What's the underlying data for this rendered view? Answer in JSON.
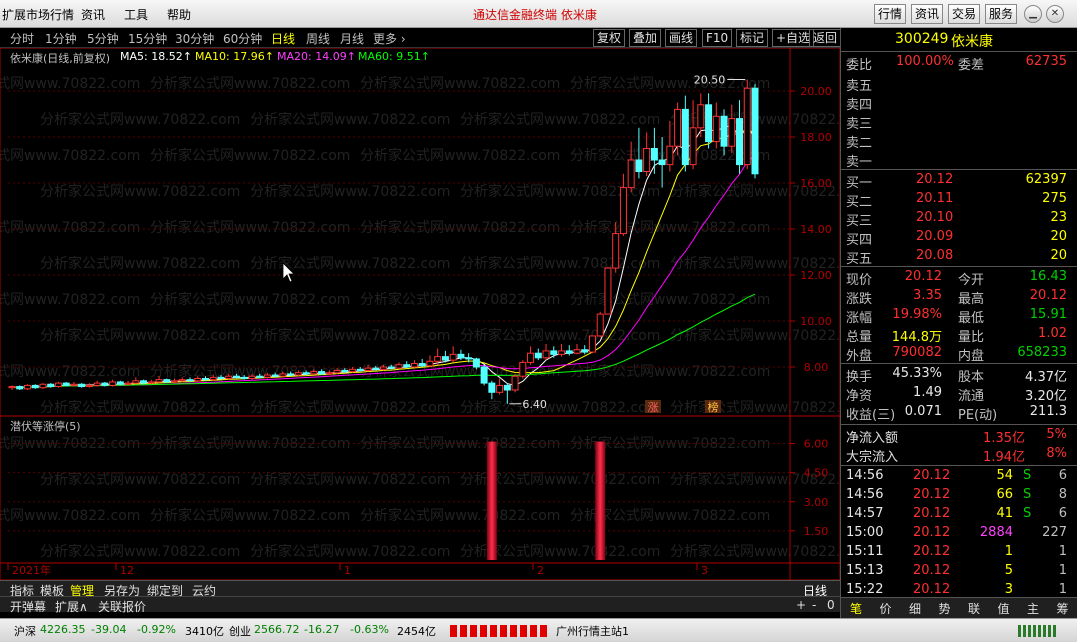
{
  "titlebar": {
    "menus": [
      "扩展市场行情",
      "资讯",
      "工具",
      "帮助"
    ],
    "center_title": "通达信金融终端   依米康",
    "buttons": [
      "行情",
      "资讯",
      "交易",
      "服务"
    ]
  },
  "periods": [
    "分时",
    "1分钟",
    "5分钟",
    "15分钟",
    "30分钟",
    "60分钟",
    "日线",
    "周线",
    "月线",
    "更多 ›"
  ],
  "active_period": "日线",
  "tools": [
    "复权",
    "叠加",
    "画线",
    "F10",
    "标记",
    "+自选",
    "返回"
  ],
  "ma_legend": {
    "name": "依米康(日线,前复权)",
    "ma5": "MA5: 18.52↑",
    "ma10": "MA10: 17.96↑",
    "ma20": "MA20: 14.09↑",
    "ma60": "MA60: 9.51↑"
  },
  "chart_data": {
    "type": "candlestick",
    "price_axis_ticks": [
      "20.00",
      "18.00",
      "16.00",
      "14.00",
      "12.00",
      "10.00",
      "8.00"
    ],
    "ylim": [
      6.0,
      21.0
    ],
    "high_annotation": "20.50",
    "low_annotation": "6.40",
    "x_labels": [
      "2021年",
      "12",
      "1",
      "2",
      "3"
    ],
    "markers": [
      "涨",
      "榜"
    ],
    "candles": [
      [
        7.1,
        7.15,
        7.0,
        7.2
      ],
      [
        7.15,
        7.05,
        7.0,
        7.2
      ],
      [
        7.05,
        7.2,
        7.0,
        7.25
      ],
      [
        7.2,
        7.1,
        7.05,
        7.25
      ],
      [
        7.1,
        7.25,
        7.05,
        7.3
      ],
      [
        7.25,
        7.15,
        7.1,
        7.3
      ],
      [
        7.15,
        7.3,
        7.1,
        7.35
      ],
      [
        7.3,
        7.2,
        7.15,
        7.35
      ],
      [
        7.2,
        7.25,
        7.15,
        7.35
      ],
      [
        7.25,
        7.15,
        7.1,
        7.3
      ],
      [
        7.15,
        7.2,
        7.1,
        7.3
      ],
      [
        7.2,
        7.3,
        7.15,
        7.4
      ],
      [
        7.3,
        7.2,
        7.15,
        7.35
      ],
      [
        7.2,
        7.35,
        7.15,
        7.45
      ],
      [
        7.35,
        7.25,
        7.2,
        7.4
      ],
      [
        7.25,
        7.3,
        7.2,
        7.4
      ],
      [
        7.3,
        7.4,
        7.25,
        7.55
      ],
      [
        7.4,
        7.3,
        7.25,
        7.45
      ],
      [
        7.3,
        7.35,
        7.25,
        7.45
      ],
      [
        7.35,
        7.45,
        7.3,
        7.6
      ],
      [
        7.45,
        7.35,
        7.3,
        7.5
      ],
      [
        7.35,
        7.4,
        7.3,
        7.5
      ],
      [
        7.4,
        7.45,
        7.35,
        7.55
      ],
      [
        7.45,
        7.4,
        7.35,
        7.55
      ],
      [
        7.4,
        7.5,
        7.35,
        7.6
      ],
      [
        7.5,
        7.45,
        7.4,
        7.6
      ],
      [
        7.45,
        7.55,
        7.4,
        7.65
      ],
      [
        7.55,
        7.5,
        7.45,
        7.65
      ],
      [
        7.5,
        7.6,
        7.45,
        7.7
      ],
      [
        7.6,
        7.55,
        7.5,
        7.7
      ],
      [
        7.55,
        7.5,
        7.45,
        7.65
      ],
      [
        7.5,
        7.6,
        7.45,
        7.7
      ],
      [
        7.6,
        7.55,
        7.5,
        7.7
      ],
      [
        7.55,
        7.65,
        7.5,
        7.75
      ],
      [
        7.65,
        7.6,
        7.55,
        7.75
      ],
      [
        7.6,
        7.7,
        7.55,
        7.8
      ],
      [
        7.7,
        7.65,
        7.6,
        7.8
      ],
      [
        7.65,
        7.75,
        7.6,
        7.85
      ],
      [
        7.75,
        7.7,
        7.65,
        7.85
      ],
      [
        7.7,
        7.8,
        7.65,
        7.9
      ],
      [
        7.8,
        7.7,
        7.65,
        7.9
      ],
      [
        7.7,
        7.75,
        7.65,
        7.85
      ],
      [
        7.75,
        7.85,
        7.7,
        7.95
      ],
      [
        7.85,
        7.8,
        7.75,
        7.95
      ],
      [
        7.8,
        7.9,
        7.75,
        8.0
      ],
      [
        7.9,
        7.85,
        7.8,
        8.0
      ],
      [
        7.85,
        7.95,
        7.8,
        8.1
      ],
      [
        7.95,
        7.9,
        7.85,
        8.05
      ],
      [
        7.9,
        8.0,
        7.85,
        8.1
      ],
      [
        8.0,
        7.95,
        7.9,
        8.1
      ],
      [
        7.95,
        8.1,
        7.9,
        8.2
      ],
      [
        8.1,
        8.0,
        7.95,
        8.25
      ],
      [
        8.0,
        8.15,
        7.95,
        8.3
      ],
      [
        8.15,
        8.05,
        8.0,
        8.35
      ],
      [
        8.05,
        8.25,
        8.0,
        8.5
      ],
      [
        8.25,
        8.45,
        8.1,
        8.8
      ],
      [
        8.45,
        8.3,
        8.2,
        8.7
      ],
      [
        8.3,
        8.55,
        8.2,
        8.9
      ],
      [
        8.55,
        8.4,
        8.3,
        8.75
      ],
      [
        8.4,
        8.35,
        8.2,
        8.6
      ],
      [
        8.35,
        8.0,
        7.9,
        8.4
      ],
      [
        8.0,
        7.3,
        7.2,
        8.1
      ],
      [
        7.3,
        6.9,
        6.6,
        7.4
      ],
      [
        6.9,
        7.2,
        6.8,
        7.5
      ],
      [
        7.2,
        7.0,
        6.4,
        7.3
      ],
      [
        7.0,
        7.6,
        6.9,
        7.7
      ],
      [
        7.6,
        8.2,
        7.5,
        8.3
      ],
      [
        8.2,
        8.6,
        8.1,
        8.9
      ],
      [
        8.6,
        8.4,
        8.3,
        8.8
      ],
      [
        8.4,
        8.7,
        8.3,
        9.0
      ],
      [
        8.7,
        8.55,
        8.4,
        8.9
      ],
      [
        8.55,
        8.7,
        8.45,
        9.0
      ],
      [
        8.7,
        8.6,
        8.5,
        8.95
      ],
      [
        8.6,
        8.75,
        8.55,
        9.0
      ],
      [
        8.75,
        8.65,
        8.55,
        8.95
      ],
      [
        8.65,
        9.35,
        8.6,
        9.35
      ],
      [
        9.35,
        10.3,
        9.3,
        10.4
      ],
      [
        10.3,
        12.3,
        10.3,
        12.35
      ],
      [
        12.3,
        13.8,
        12.1,
        14.3
      ],
      [
        13.8,
        15.8,
        13.7,
        16.4
      ],
      [
        15.8,
        17.0,
        15.6,
        17.8
      ],
      [
        17.0,
        16.5,
        16.2,
        18.4
      ],
      [
        16.5,
        17.5,
        16.3,
        18.2
      ],
      [
        17.5,
        17.0,
        16.4,
        18.4
      ],
      [
        17.0,
        16.8,
        15.8,
        18.0
      ],
      [
        16.8,
        17.6,
        16.5,
        18.7
      ],
      [
        17.6,
        19.2,
        17.2,
        19.5
      ],
      [
        19.2,
        16.8,
        16.5,
        19.8
      ],
      [
        16.8,
        18.4,
        16.6,
        19.6
      ],
      [
        18.4,
        19.4,
        18.0,
        19.9
      ],
      [
        19.4,
        17.8,
        17.5,
        19.9
      ],
      [
        17.8,
        18.9,
        17.5,
        19.5
      ],
      [
        18.9,
        17.6,
        17.2,
        19.2
      ],
      [
        17.6,
        18.8,
        17.3,
        19.4
      ],
      [
        18.8,
        16.8,
        16.4,
        19.6
      ],
      [
        16.8,
        20.12,
        16.6,
        20.5
      ],
      [
        20.12,
        16.4,
        16.2,
        20.3
      ]
    ],
    "ma_colors": {
      "ma5": "#ffffff",
      "ma10": "#ffff00",
      "ma20": "#ff00ff",
      "ma60": "#00ff00"
    }
  },
  "indicator": {
    "title": "潜伏等涨停(5)",
    "ticks": [
      "6.00",
      "4.50",
      "3.00",
      "1.50"
    ],
    "bars_at": [
      62,
      76
    ]
  },
  "bottom_tabs": [
    "指标",
    "模板",
    "管理",
    "另存为",
    "绑定到",
    "云约"
  ],
  "period_label": "日线",
  "sub_tabs": [
    "开弹幕",
    "扩展∧",
    "关联报价"
  ],
  "scroll_controls": [
    "+",
    "-",
    "0"
  ],
  "stock": {
    "code": "300249",
    "name": "依米康"
  },
  "weibi": {
    "label": "委比",
    "value": "100.00%",
    "label2": "委差",
    "value2": "62735"
  },
  "sells": [
    {
      "label": "卖五",
      "price": "",
      "vol": ""
    },
    {
      "label": "卖四",
      "price": "",
      "vol": ""
    },
    {
      "label": "卖三",
      "price": "",
      "vol": ""
    },
    {
      "label": "卖二",
      "price": "",
      "vol": ""
    },
    {
      "label": "卖一",
      "price": "",
      "vol": ""
    }
  ],
  "buys": [
    {
      "label": "买一",
      "price": "20.12",
      "vol": "62397"
    },
    {
      "label": "买二",
      "price": "20.11",
      "vol": "275"
    },
    {
      "label": "买三",
      "price": "20.10",
      "vol": "23"
    },
    {
      "label": "买四",
      "price": "20.09",
      "vol": "20"
    },
    {
      "label": "买五",
      "price": "20.08",
      "vol": "20"
    }
  ],
  "quote": [
    {
      "l1": "现价",
      "v1": "20.12",
      "c1": "red",
      "l2": "今开",
      "v2": "16.43",
      "c2": "grn"
    },
    {
      "l1": "涨跌",
      "v1": "3.35",
      "c1": "red",
      "l2": "最高",
      "v2": "20.12",
      "c2": "red"
    },
    {
      "l1": "涨幅",
      "v1": "19.98%",
      "c1": "red",
      "l2": "最低",
      "v2": "15.91",
      "c2": "grn"
    },
    {
      "l1": "总量",
      "v1": "144.8万",
      "c1": "yel",
      "l2": "量比",
      "v2": "1.02",
      "c2": "red"
    },
    {
      "l1": "外盘",
      "v1": "790082",
      "c1": "red",
      "l2": "内盘",
      "v2": "658233",
      "c2": "grn"
    }
  ],
  "finance": [
    {
      "l1": "换手",
      "v1": "45.33%",
      "l2": "股本",
      "v2": "4.37亿"
    },
    {
      "l1": "净资",
      "v1": "1.49",
      "l2": "流通",
      "v2": "3.20亿"
    },
    {
      "l1": "收益(三)",
      "v1": "0.071",
      "l2": "PE(动)",
      "v2": "211.3"
    }
  ],
  "flows": [
    {
      "label": "净流入额",
      "value": "1.35亿",
      "pct": "5%"
    },
    {
      "label": "大宗流入",
      "value": "1.94亿",
      "pct": "8%"
    }
  ],
  "ticks": [
    {
      "time": "14:56",
      "price": "20.12",
      "vol": "54",
      "side": "S",
      "num": "6"
    },
    {
      "time": "14:56",
      "price": "20.12",
      "vol": "66",
      "side": "S",
      "num": "8"
    },
    {
      "time": "14:57",
      "price": "20.12",
      "vol": "41",
      "side": "S",
      "num": "6"
    },
    {
      "time": "15:00",
      "price": "20.12",
      "vol": "2884",
      "side": "",
      "num": "227"
    },
    {
      "time": "15:11",
      "price": "20.12",
      "vol": "1",
      "side": "",
      "num": "1"
    },
    {
      "time": "15:13",
      "price": "20.12",
      "vol": "5",
      "side": "",
      "num": "1"
    },
    {
      "time": "15:22",
      "price": "20.12",
      "vol": "3",
      "side": "",
      "num": "1"
    }
  ],
  "right_tabs": [
    "笔",
    "价",
    "细",
    "势",
    "联",
    "值",
    "主",
    "筹"
  ],
  "status": {
    "sh_label": "沪深",
    "sh_index": "4226.35",
    "sh_chg": "-39.04",
    "sh_pct": "-0.92%",
    "sh_amt": "3410亿",
    "cy_label": "创业",
    "cy_index": "2566.72",
    "cy_chg": "-16.27",
    "cy_pct": "-0.63%",
    "cy_amt": "2454亿",
    "server": "广州行情主站1"
  },
  "watermark": "分析家公式网www.70822.com"
}
